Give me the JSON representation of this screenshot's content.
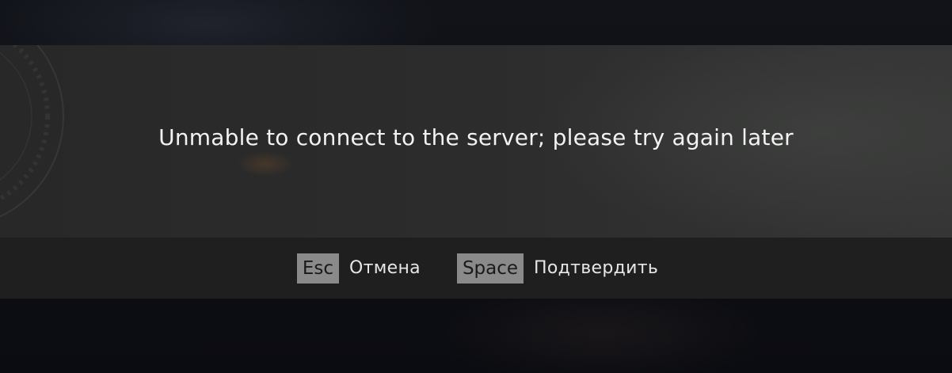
{
  "dialog": {
    "message": "Unmable to connect to the server; please try again later"
  },
  "footer": {
    "hints": [
      {
        "key": "Esc",
        "label": "Отмена"
      },
      {
        "key": "Space",
        "label": "Подтвердить"
      }
    ]
  },
  "colors": {
    "panel": "#2c2c2c",
    "footer": "#1f1f1f",
    "key_badge": "#8a8a8a",
    "text": "#f2f2f2"
  }
}
